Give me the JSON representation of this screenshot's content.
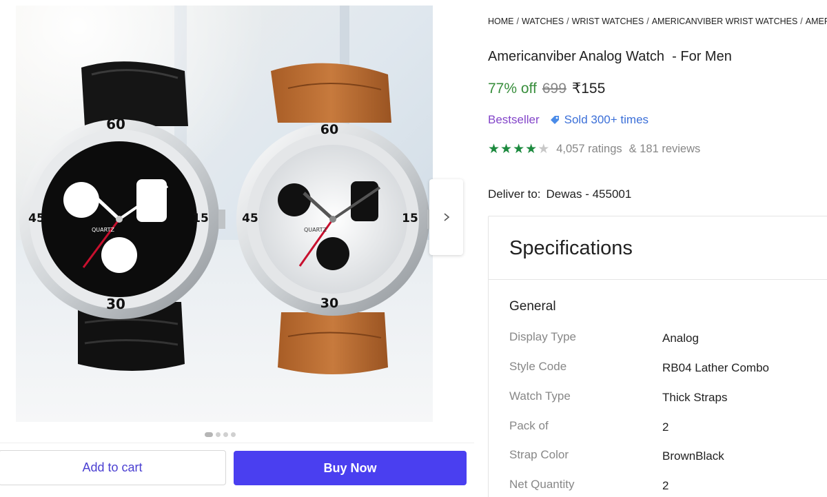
{
  "breadcrumb": [
    "HOME",
    "WATCHES",
    "WRIST WATCHES",
    "AMERICANVIBER WRIST WATCHES",
    "AMER"
  ],
  "product": {
    "title": "Americanviber Analog Watch  - For Men",
    "discount": "77% off",
    "mrp": "699",
    "price": "₹155",
    "bestseller": "Bestseller",
    "sold": "Sold 300+ times",
    "rating_stars": 4,
    "ratings": "4,057 ratings",
    "reviews": "& 181 reviews"
  },
  "delivery": {
    "label": "Deliver to:",
    "location": "Dewas - 455001"
  },
  "gallery": {
    "dial_top": "60",
    "dial_right": "15",
    "dial_bottom": "30",
    "dial_left": "45",
    "quartz": "QUARTZ"
  },
  "actions": {
    "add_to_cart": "Add to cart",
    "buy_now": "Buy Now"
  },
  "specs": {
    "title": "Specifications",
    "group": "General",
    "rows": [
      {
        "label": "Display Type",
        "value": "Analog"
      },
      {
        "label": "Style Code",
        "value": "RB04 Lather Combo"
      },
      {
        "label": "Watch Type",
        "value": "Thick Straps"
      },
      {
        "label": "Pack of",
        "value": "2"
      },
      {
        "label": "Strap Color",
        "value": "BrownBlack"
      },
      {
        "label": "Net Quantity",
        "value": "2"
      }
    ]
  },
  "colors": {
    "accent": "#4a3ff0",
    "discount_green": "#388e3c",
    "star_green": "#1c8a3e",
    "bestseller_purple": "#8345c9",
    "sold_blue": "#3b6fd8"
  },
  "icons": {
    "next": "chevron-right-icon",
    "sold": "tag-icon",
    "star": "star-icon"
  }
}
